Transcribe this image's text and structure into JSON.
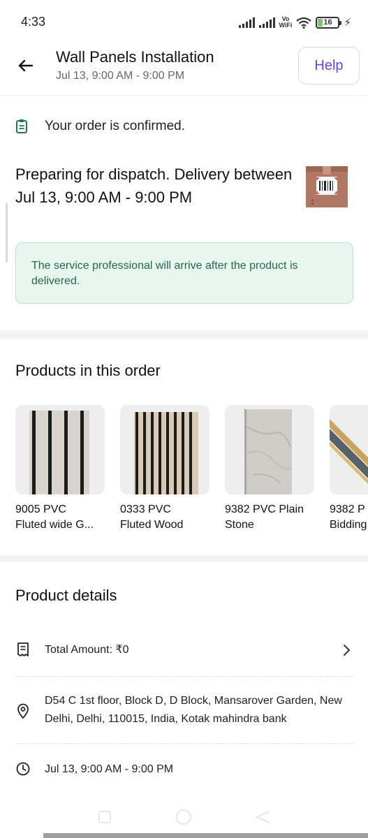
{
  "status_bar": {
    "time": "4:33",
    "network_label": "Vo\nWiFi",
    "battery": "16",
    "icons": [
      "signal-icon",
      "signal-icon",
      "vowifi-icon",
      "wifi-icon",
      "battery-icon",
      "charging-bolt-icon"
    ]
  },
  "header": {
    "title": "Wall Panels Installation",
    "subtitle": "Jul 13, 9:00 AM - 9:00 PM",
    "help_label": "Help",
    "back_icon": "arrow-left-icon"
  },
  "order": {
    "status": "Your order is confirmed.",
    "status_icon": "clipboard-icon",
    "dispatch": "Preparing for dispatch. Delivery between Jul 13, 9:00 AM - 9:00 PM",
    "notice": "The service professional will arrive after the product is delivered."
  },
  "products": {
    "title": "Products in this order",
    "items": [
      {
        "name_line1": "9005 PVC",
        "name_line2": "Fluted wide G..."
      },
      {
        "name_line1": "0333 PVC",
        "name_line2": "Fluted Wood"
      },
      {
        "name_line1": "9382 PVC Plain",
        "name_line2": "Stone"
      },
      {
        "name_line1": "9382 P",
        "name_line2": "Bidding"
      }
    ]
  },
  "details": {
    "title": "Product details",
    "total": "Total Amount: ₹0",
    "address": "D54 C 1st floor, Block D, D Block, Mansarover Garden, New Delhi, Delhi, 110015, India, Kotak mahindra bank",
    "time": "Jul 13, 9:00 AM - 9:00 PM",
    "icons": [
      "receipt-icon",
      "location-pin-icon",
      "clock-icon",
      "chevron-right-icon"
    ]
  },
  "colors": {
    "accent": "#6e42e5",
    "notice_bg": "#e8f6ef",
    "notice_text": "#1e6b4b",
    "confirm_icon": "#1e7a55"
  }
}
